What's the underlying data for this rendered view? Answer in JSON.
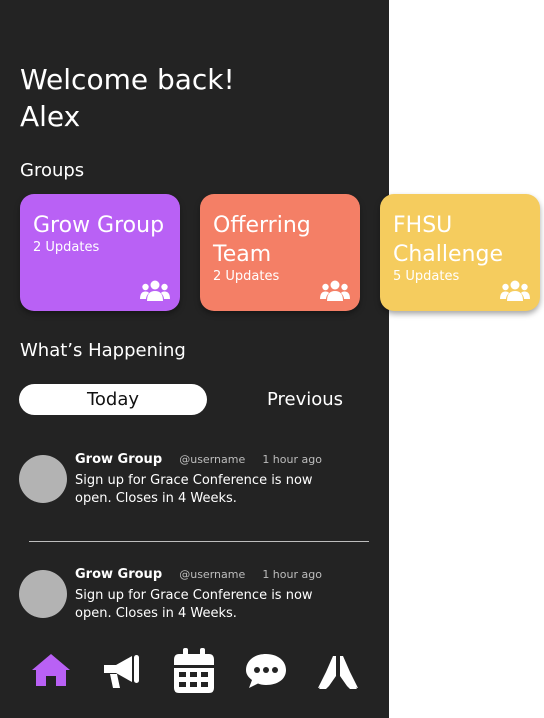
{
  "welcome": {
    "line1": "Welcome back!",
    "line2": "Alex"
  },
  "groups_title": "Groups",
  "groups": [
    {
      "name": "Grow Group",
      "updates": "2 Updates",
      "color": "#b961f5"
    },
    {
      "name": "Offerring Team",
      "updates": "2 Updates",
      "color": "#f47f66"
    },
    {
      "name": "FHSU Challenge",
      "updates": "5 Updates",
      "color": "#f5cc5e"
    }
  ],
  "happening_title": "What’s Happening",
  "tabs": {
    "today": "Today",
    "previous": "Previous"
  },
  "posts": [
    {
      "group": "Grow Group",
      "username": "@username",
      "time": "1 hour ago",
      "text": "Sign up for Grace Conference is now open. Closes in 4 Weeks."
    },
    {
      "group": "Grow Group",
      "username": "@username",
      "time": "1 hour ago",
      "text": "Sign up for Grace Conference is now open. Closes in 4 Weeks."
    }
  ],
  "nav": {
    "items": [
      "home-icon",
      "megaphone-icon",
      "calendar-icon",
      "chat-icon",
      "praying-hands-icon"
    ],
    "active_color": "#b961f5",
    "color": "#ffffff"
  }
}
